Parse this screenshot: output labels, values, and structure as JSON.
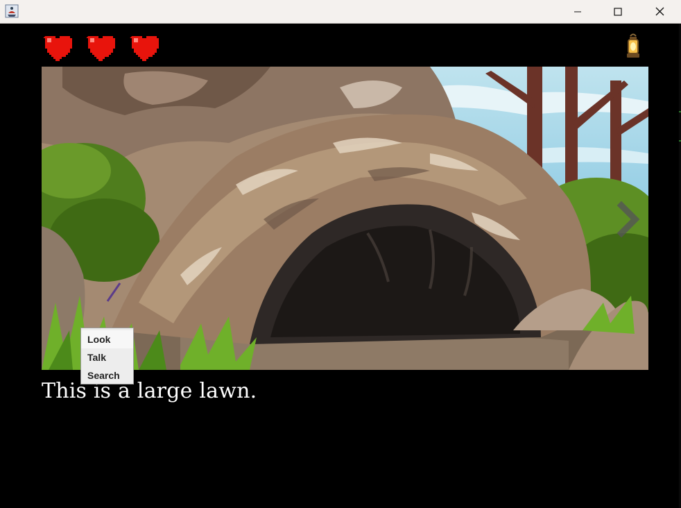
{
  "window": {
    "controls": [
      "minimize",
      "maximize",
      "close"
    ],
    "app_icon": "java-cup-icon"
  },
  "hud": {
    "hearts": 3,
    "heart_color": "#e8140c",
    "lantern_icon": "lantern-icon"
  },
  "scene": {
    "next_arrow_icon": "chevron-right-icon"
  },
  "narration": {
    "text": "This is a large lawn."
  },
  "context_menu": {
    "items": [
      "Look",
      "Talk",
      "Search"
    ]
  }
}
